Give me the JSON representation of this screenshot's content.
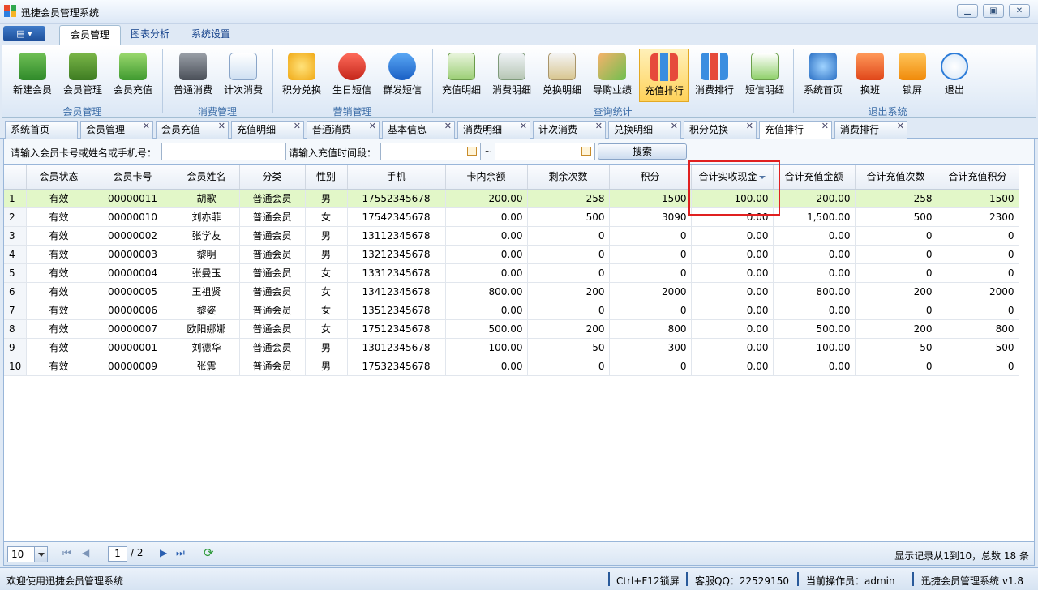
{
  "window": {
    "title": "迅捷会员管理系统"
  },
  "ribbon_tabs": [
    "会员管理",
    "图表分析",
    "系统设置"
  ],
  "ribbon_buttons": [
    {
      "label": "新建会员",
      "icon": "contact-book-icon"
    },
    {
      "label": "会员管理",
      "icon": "address-book-icon"
    },
    {
      "label": "会员充值",
      "icon": "water-drop-icon"
    },
    {
      "label": "普通消费",
      "icon": "cash-register-icon"
    },
    {
      "label": "计次消费",
      "icon": "calendar-plus-icon"
    },
    {
      "label": "积分兑换",
      "icon": "coins-icon"
    },
    {
      "label": "生日短信",
      "icon": "sms-red-icon"
    },
    {
      "label": "群发短信",
      "icon": "sms-blue-icon"
    },
    {
      "label": "充值明细",
      "icon": "ledger-green-icon"
    },
    {
      "label": "消费明细",
      "icon": "ledger-icon"
    },
    {
      "label": "兑换明细",
      "icon": "receipt-coins-icon"
    },
    {
      "label": "导购业绩",
      "icon": "growth-chart-icon"
    },
    {
      "label": "充值排行",
      "icon": "bar-chart-icon"
    },
    {
      "label": "消费排行",
      "icon": "bar-chart-2-icon"
    },
    {
      "label": "短信明细",
      "icon": "note-icon"
    },
    {
      "label": "系统首页",
      "icon": "compass-icon"
    },
    {
      "label": "换班",
      "icon": "shift-swap-icon"
    },
    {
      "label": "锁屏",
      "icon": "lock-icon"
    },
    {
      "label": "退出",
      "icon": "power-icon"
    }
  ],
  "ribbon_groups": [
    "会员管理",
    "消费管理",
    "营销管理",
    "查询统计",
    "退出系统"
  ],
  "doc_tabs": [
    "系统首页",
    "会员管理",
    "会员充值",
    "充值明细",
    "普通消费",
    "基本信息",
    "消费明细",
    "计次消费",
    "兑换明细",
    "积分兑换",
    "充值排行",
    "消费排行"
  ],
  "search": {
    "keyword_label": "请输入会员卡号或姓名或手机号：",
    "keyword_value": "",
    "date_label": "请输入充值时间段：",
    "date_from": "",
    "date_sep": "~",
    "date_to": "",
    "button": "搜索"
  },
  "table": {
    "columns": [
      "",
      "会员状态",
      "会员卡号",
      "会员姓名",
      "分类",
      "性别",
      "手机",
      "卡内余额",
      "剩余次数",
      "积分",
      "合计实收现金",
      "合计充值金额",
      "合计充值次数",
      "合计充值积分"
    ],
    "sorted_column": "合计实收现金",
    "rows": [
      [
        "1",
        "有效",
        "00000011",
        "胡歌",
        "普通会员",
        "男",
        "17552345678",
        "200.00",
        "258",
        "1500",
        "100.00",
        "200.00",
        "258",
        "1500"
      ],
      [
        "2",
        "有效",
        "00000010",
        "刘亦菲",
        "普通会员",
        "女",
        "17542345678",
        "0.00",
        "500",
        "3090",
        "0.00",
        "1,500.00",
        "500",
        "2300"
      ],
      [
        "3",
        "有效",
        "00000002",
        "张学友",
        "普通会员",
        "男",
        "13112345678",
        "0.00",
        "0",
        "0",
        "0.00",
        "0.00",
        "0",
        "0"
      ],
      [
        "4",
        "有效",
        "00000003",
        "黎明",
        "普通会员",
        "男",
        "13212345678",
        "0.00",
        "0",
        "0",
        "0.00",
        "0.00",
        "0",
        "0"
      ],
      [
        "5",
        "有效",
        "00000004",
        "张曼玉",
        "普通会员",
        "女",
        "13312345678",
        "0.00",
        "0",
        "0",
        "0.00",
        "0.00",
        "0",
        "0"
      ],
      [
        "6",
        "有效",
        "00000005",
        "王祖贤",
        "普通会员",
        "女",
        "13412345678",
        "800.00",
        "200",
        "2000",
        "0.00",
        "800.00",
        "200",
        "2000"
      ],
      [
        "7",
        "有效",
        "00000006",
        "黎姿",
        "普通会员",
        "女",
        "13512345678",
        "0.00",
        "0",
        "0",
        "0.00",
        "0.00",
        "0",
        "0"
      ],
      [
        "8",
        "有效",
        "00000007",
        "欧阳娜娜",
        "普通会员",
        "女",
        "17512345678",
        "500.00",
        "200",
        "800",
        "0.00",
        "500.00",
        "200",
        "800"
      ],
      [
        "9",
        "有效",
        "00000001",
        "刘德华",
        "普通会员",
        "男",
        "13012345678",
        "100.00",
        "50",
        "300",
        "0.00",
        "100.00",
        "50",
        "500"
      ],
      [
        "10",
        "有效",
        "00000009",
        "张震",
        "普通会员",
        "男",
        "17532345678",
        "0.00",
        "0",
        "0",
        "0.00",
        "0.00",
        "0",
        "0"
      ]
    ]
  },
  "pager": {
    "page_size": "10",
    "page": "1",
    "total_pages": "/ 2",
    "info": "显示记录从1到10，总数 18 条"
  },
  "status": {
    "welcome": "欢迎使用迅捷会员管理系统",
    "shortcut": "Ctrl+F12锁屏",
    "support": "客服QQ：22529150",
    "operator": "当前操作员：admin",
    "version": "迅捷会员管理系统 v1.8"
  }
}
